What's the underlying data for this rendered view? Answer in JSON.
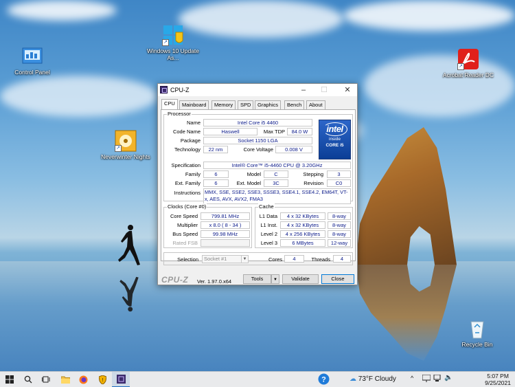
{
  "desktop": {
    "icons": [
      {
        "name": "control-panel",
        "label": "Control Panel"
      },
      {
        "name": "windows-update-assistant",
        "label": "Windows 10 Update As..."
      },
      {
        "name": "acrobat-reader",
        "label": "Acrobat Reader DC"
      },
      {
        "name": "neverwinter-nights",
        "label": "Neverwinter Nights"
      },
      {
        "name": "recycle-bin",
        "label": "Recycle Bin"
      }
    ]
  },
  "window": {
    "title": "CPU-Z",
    "tabs": [
      "CPU",
      "Mainboard",
      "Memory",
      "SPD",
      "Graphics",
      "Bench",
      "About"
    ],
    "active_tab": "CPU",
    "processor": {
      "group_label": "Processor",
      "name_label": "Name",
      "name": "Intel Core i5 4460",
      "codename_label": "Code Name",
      "codename": "Haswell",
      "maxtdp_label": "Max TDP",
      "maxtdp": "84.0 W",
      "package_label": "Package",
      "package": "Socket 1150 LGA",
      "technology_label": "Technology",
      "technology": "22 nm",
      "corevoltage_label": "Core Voltage",
      "corevoltage": "0.008 V",
      "specification_label": "Specification",
      "specification": "Intel® Core™ i5-4460  CPU @ 3.20GHz",
      "family_label": "Family",
      "family": "6",
      "model_label": "Model",
      "model": "C",
      "stepping_label": "Stepping",
      "stepping": "3",
      "extfamily_label": "Ext. Family",
      "extfamily": "6",
      "extmodel_label": "Ext. Model",
      "extmodel": "3C",
      "revision_label": "Revision",
      "revision": "C0",
      "instructions_label": "Instructions",
      "instructions": "MMX, SSE, SSE2, SSE3, SSSE3, SSE4.1, SSE4.2, EM64T, VT-x, AES, AVX, AVX2, FMA3",
      "logo": {
        "brand": "intel",
        "inside": "inside",
        "core": "CORE i5"
      }
    },
    "clocks": {
      "group_label": "Clocks (Core #0)",
      "corespeed_label": "Core Speed",
      "corespeed": "799.81 MHz",
      "multiplier_label": "Multiplier",
      "multiplier": "x 8.0 ( 8 - 34 )",
      "busspeed_label": "Bus Speed",
      "busspeed": "99.98 MHz",
      "ratedfsb_label": "Rated FSB",
      "ratedfsb": ""
    },
    "cache": {
      "group_label": "Cache",
      "rows": [
        {
          "label": "L1 Data",
          "size": "4 x 32 KBytes",
          "way": "8-way"
        },
        {
          "label": "L1 Inst.",
          "size": "4 x 32 KBytes",
          "way": "8-way"
        },
        {
          "label": "Level 2",
          "size": "4 x 256 KBytes",
          "way": "8-way"
        },
        {
          "label": "Level 3",
          "size": "6 MBytes",
          "way": "12-way"
        }
      ]
    },
    "selection": {
      "label": "Selection",
      "value": "Socket #1",
      "cores_label": "Cores",
      "cores": "4",
      "threads_label": "Threads",
      "threads": "4"
    },
    "footer": {
      "brand": "CPU-Z",
      "version": "Ver. 1.97.0.x64",
      "tools": "Tools",
      "validate": "Validate",
      "close": "Close"
    }
  },
  "taskbar": {
    "weather": "73°F  Cloudy",
    "time": "5:07 PM",
    "date": "9/25/2021"
  },
  "colors": {
    "value_text": "#0b1a8a",
    "taskbar": "#e9eaec",
    "intel_blue": "#0b3e96"
  }
}
